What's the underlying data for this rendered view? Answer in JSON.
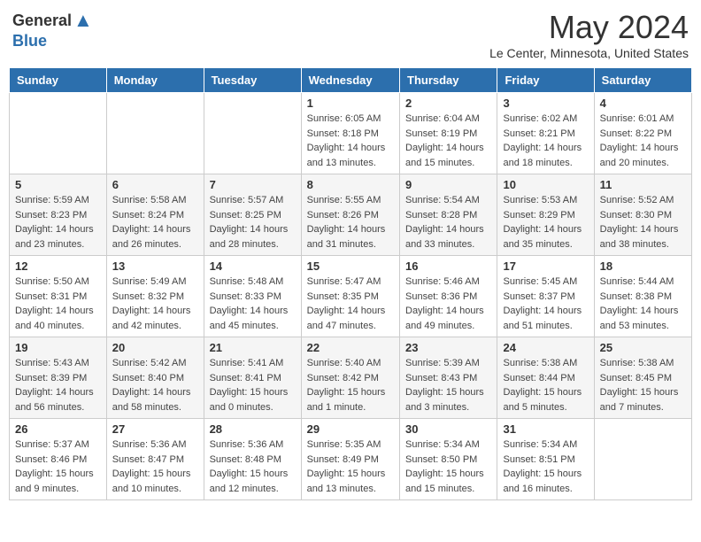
{
  "header": {
    "logo_general": "General",
    "logo_blue": "Blue",
    "month_title": "May 2024",
    "location": "Le Center, Minnesota, United States"
  },
  "calendar": {
    "days_of_week": [
      "Sunday",
      "Monday",
      "Tuesday",
      "Wednesday",
      "Thursday",
      "Friday",
      "Saturday"
    ],
    "weeks": [
      [
        {
          "day": "",
          "info": ""
        },
        {
          "day": "",
          "info": ""
        },
        {
          "day": "",
          "info": ""
        },
        {
          "day": "1",
          "info": "Sunrise: 6:05 AM\nSunset: 8:18 PM\nDaylight: 14 hours and 13 minutes."
        },
        {
          "day": "2",
          "info": "Sunrise: 6:04 AM\nSunset: 8:19 PM\nDaylight: 14 hours and 15 minutes."
        },
        {
          "day": "3",
          "info": "Sunrise: 6:02 AM\nSunset: 8:21 PM\nDaylight: 14 hours and 18 minutes."
        },
        {
          "day": "4",
          "info": "Sunrise: 6:01 AM\nSunset: 8:22 PM\nDaylight: 14 hours and 20 minutes."
        }
      ],
      [
        {
          "day": "5",
          "info": "Sunrise: 5:59 AM\nSunset: 8:23 PM\nDaylight: 14 hours and 23 minutes."
        },
        {
          "day": "6",
          "info": "Sunrise: 5:58 AM\nSunset: 8:24 PM\nDaylight: 14 hours and 26 minutes."
        },
        {
          "day": "7",
          "info": "Sunrise: 5:57 AM\nSunset: 8:25 PM\nDaylight: 14 hours and 28 minutes."
        },
        {
          "day": "8",
          "info": "Sunrise: 5:55 AM\nSunset: 8:26 PM\nDaylight: 14 hours and 31 minutes."
        },
        {
          "day": "9",
          "info": "Sunrise: 5:54 AM\nSunset: 8:28 PM\nDaylight: 14 hours and 33 minutes."
        },
        {
          "day": "10",
          "info": "Sunrise: 5:53 AM\nSunset: 8:29 PM\nDaylight: 14 hours and 35 minutes."
        },
        {
          "day": "11",
          "info": "Sunrise: 5:52 AM\nSunset: 8:30 PM\nDaylight: 14 hours and 38 minutes."
        }
      ],
      [
        {
          "day": "12",
          "info": "Sunrise: 5:50 AM\nSunset: 8:31 PM\nDaylight: 14 hours and 40 minutes."
        },
        {
          "day": "13",
          "info": "Sunrise: 5:49 AM\nSunset: 8:32 PM\nDaylight: 14 hours and 42 minutes."
        },
        {
          "day": "14",
          "info": "Sunrise: 5:48 AM\nSunset: 8:33 PM\nDaylight: 14 hours and 45 minutes."
        },
        {
          "day": "15",
          "info": "Sunrise: 5:47 AM\nSunset: 8:35 PM\nDaylight: 14 hours and 47 minutes."
        },
        {
          "day": "16",
          "info": "Sunrise: 5:46 AM\nSunset: 8:36 PM\nDaylight: 14 hours and 49 minutes."
        },
        {
          "day": "17",
          "info": "Sunrise: 5:45 AM\nSunset: 8:37 PM\nDaylight: 14 hours and 51 minutes."
        },
        {
          "day": "18",
          "info": "Sunrise: 5:44 AM\nSunset: 8:38 PM\nDaylight: 14 hours and 53 minutes."
        }
      ],
      [
        {
          "day": "19",
          "info": "Sunrise: 5:43 AM\nSunset: 8:39 PM\nDaylight: 14 hours and 56 minutes."
        },
        {
          "day": "20",
          "info": "Sunrise: 5:42 AM\nSunset: 8:40 PM\nDaylight: 14 hours and 58 minutes."
        },
        {
          "day": "21",
          "info": "Sunrise: 5:41 AM\nSunset: 8:41 PM\nDaylight: 15 hours and 0 minutes."
        },
        {
          "day": "22",
          "info": "Sunrise: 5:40 AM\nSunset: 8:42 PM\nDaylight: 15 hours and 1 minute."
        },
        {
          "day": "23",
          "info": "Sunrise: 5:39 AM\nSunset: 8:43 PM\nDaylight: 15 hours and 3 minutes."
        },
        {
          "day": "24",
          "info": "Sunrise: 5:38 AM\nSunset: 8:44 PM\nDaylight: 15 hours and 5 minutes."
        },
        {
          "day": "25",
          "info": "Sunrise: 5:38 AM\nSunset: 8:45 PM\nDaylight: 15 hours and 7 minutes."
        }
      ],
      [
        {
          "day": "26",
          "info": "Sunrise: 5:37 AM\nSunset: 8:46 PM\nDaylight: 15 hours and 9 minutes."
        },
        {
          "day": "27",
          "info": "Sunrise: 5:36 AM\nSunset: 8:47 PM\nDaylight: 15 hours and 10 minutes."
        },
        {
          "day": "28",
          "info": "Sunrise: 5:36 AM\nSunset: 8:48 PM\nDaylight: 15 hours and 12 minutes."
        },
        {
          "day": "29",
          "info": "Sunrise: 5:35 AM\nSunset: 8:49 PM\nDaylight: 15 hours and 13 minutes."
        },
        {
          "day": "30",
          "info": "Sunrise: 5:34 AM\nSunset: 8:50 PM\nDaylight: 15 hours and 15 minutes."
        },
        {
          "day": "31",
          "info": "Sunrise: 5:34 AM\nSunset: 8:51 PM\nDaylight: 15 hours and 16 minutes."
        },
        {
          "day": "",
          "info": ""
        }
      ]
    ]
  }
}
